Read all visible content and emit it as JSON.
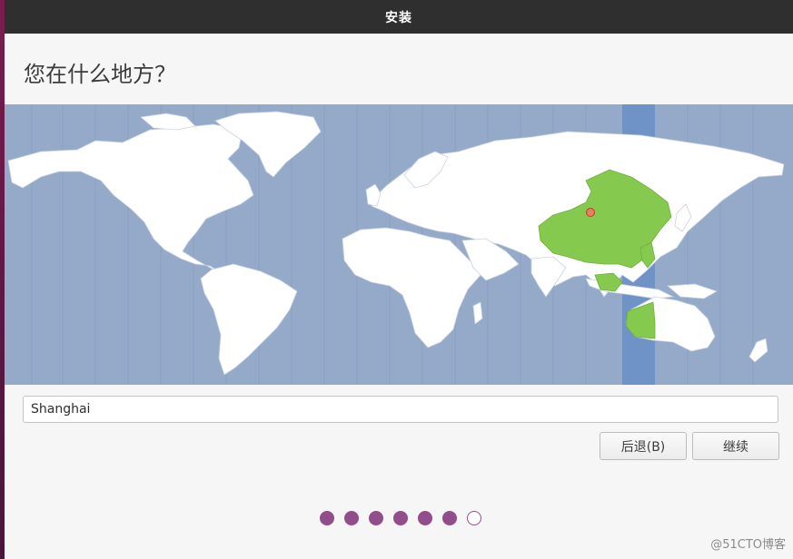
{
  "window": {
    "title": "安装"
  },
  "page": {
    "title": "您在什么地方？"
  },
  "location": {
    "value": "Shanghai",
    "selected_timezone": "Asia/Shanghai"
  },
  "buttons": {
    "back": "后退(B)",
    "continue": "继续"
  },
  "progress": {
    "total_steps": 7,
    "current_step": 7
  },
  "watermark": "@51CTO博客",
  "colors": {
    "ocean": "#95a9c9",
    "land": "#ffffff",
    "highlight": "#86c94f",
    "timezone_band": "#7093c7",
    "dot": "#924d8b",
    "titlebar": "#2f2f2f"
  },
  "icons": {
    "map_pin": "location-pin-icon"
  }
}
